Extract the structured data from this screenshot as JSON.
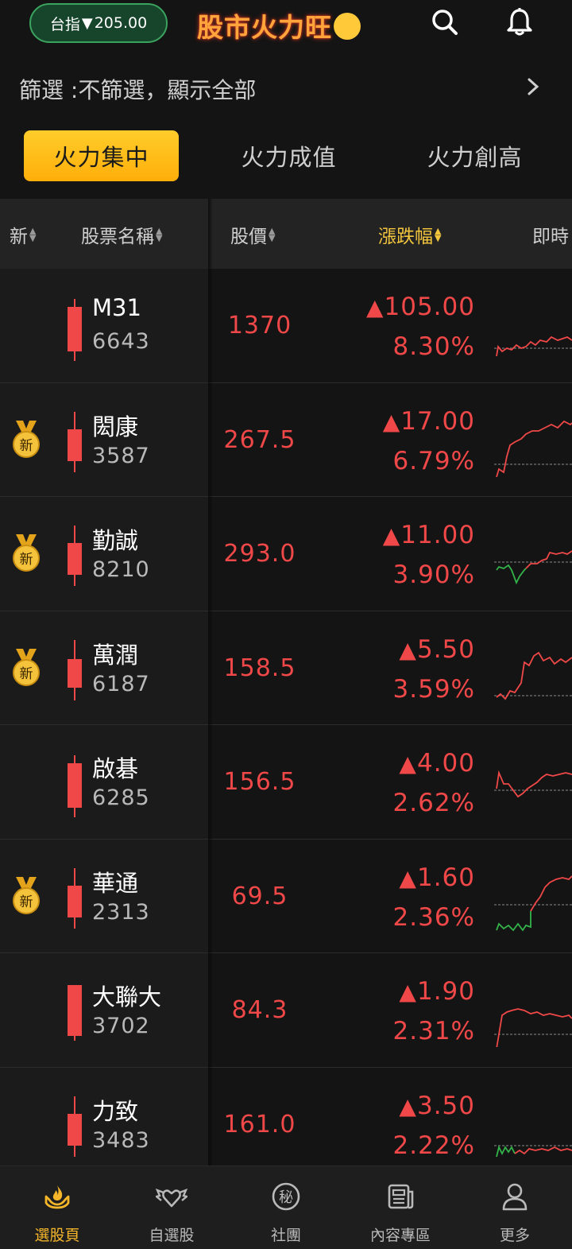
{
  "header": {
    "index_label": "台指",
    "index_arrow": "▼",
    "index_value": "205.00",
    "brand": "股市火力旺",
    "icons": [
      "search-icon",
      "bell-icon"
    ]
  },
  "filter": {
    "text": "篩選 :不篩選，顯示全部",
    "icon": "chevron-right-icon"
  },
  "tabs": [
    {
      "label": "火力集中",
      "active": true
    },
    {
      "label": "火力成值",
      "active": false
    },
    {
      "label": "火力創高",
      "active": false
    }
  ],
  "columns": {
    "new": "新",
    "name": "股票名稱",
    "price": "股價",
    "change": "漲跌幅",
    "realtime": "即時"
  },
  "colors": {
    "up": "#f04848",
    "down": "#33b34a",
    "accent": "#f5b62a",
    "pill": "#3aa35e"
  },
  "medal_text": "新",
  "rows": [
    {
      "name": "M31",
      "code": "6643",
      "price": "1370",
      "change": "105.00",
      "pct": "8.30%",
      "is_new": false,
      "candle": "up-long"
    },
    {
      "name": "閎康",
      "code": "3587",
      "price": "267.5",
      "change": "17.00",
      "pct": "6.79%",
      "is_new": true,
      "candle": "up-mid"
    },
    {
      "name": "勤誠",
      "code": "8210",
      "price": "293.0",
      "change": "11.00",
      "pct": "3.90%",
      "is_new": true,
      "candle": "up-mid"
    },
    {
      "name": "萬潤",
      "code": "6187",
      "price": "158.5",
      "change": "5.50",
      "pct": "3.59%",
      "is_new": true,
      "candle": "up-low"
    },
    {
      "name": "啟碁",
      "code": "6285",
      "price": "156.5",
      "change": "4.00",
      "pct": "2.62%",
      "is_new": false,
      "candle": "up-long"
    },
    {
      "name": "華通",
      "code": "2313",
      "price": "69.5",
      "change": "1.60",
      "pct": "2.36%",
      "is_new": true,
      "candle": "up-mid"
    },
    {
      "name": "大聯大",
      "code": "3702",
      "price": "84.3",
      "change": "1.90",
      "pct": "2.31%",
      "is_new": false,
      "candle": "up-body"
    },
    {
      "name": "力致",
      "code": "3483",
      "price": "161.0",
      "change": "3.50",
      "pct": "2.22%",
      "is_new": false,
      "candle": "up-mid"
    }
  ],
  "bottom_nav": [
    {
      "label": "選股頁",
      "icon": "fire-hand-icon",
      "active": true
    },
    {
      "label": "自選股",
      "icon": "winged-heart-icon",
      "active": false
    },
    {
      "label": "社團",
      "icon": "secret-badge-icon",
      "active": false
    },
    {
      "label": "內容專區",
      "icon": "newspaper-icon",
      "active": false
    },
    {
      "label": "更多",
      "icon": "user-icon",
      "active": false
    }
  ]
}
